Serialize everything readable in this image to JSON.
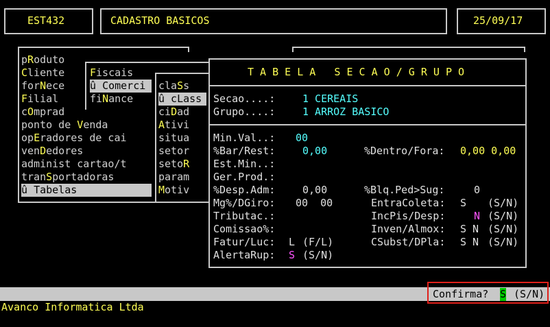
{
  "header": {
    "program": "EST432",
    "title": "CADASTRO BASICOS",
    "date": "25/09/17"
  },
  "menu1": {
    "items": [
      {
        "pre": "p",
        "key": "R",
        "post": "oduto"
      },
      {
        "pre": "",
        "key": "C",
        "post": "liente"
      },
      {
        "pre": "for",
        "key": "N",
        "post": "ece"
      },
      {
        "pre": "",
        "key": "F",
        "post": "ilial"
      },
      {
        "pre": "c",
        "key": "O",
        "post": "mprad"
      },
      {
        "pre": "ponto de ",
        "key": "V",
        "post": "enda"
      },
      {
        "pre": "op",
        "key": "E",
        "post": "radores de cai"
      },
      {
        "pre": "ven",
        "key": "D",
        "post": "edores"
      },
      {
        "pre": "administ cartao/t",
        "key": "",
        "post": ""
      },
      {
        "pre": "tran",
        "key": "S",
        "post": "portadoras"
      },
      {
        "pre": "û ",
        "key": "T",
        "post": "abelas"
      }
    ]
  },
  "menu2": {
    "items": [
      {
        "pre": "",
        "key": "F",
        "post": "iscais"
      },
      {
        "pre": "û ",
        "key": "C",
        "post": "omerci"
      },
      {
        "pre": "fi",
        "key": "N",
        "post": "ance"
      }
    ]
  },
  "menu3": {
    "items": [
      {
        "pre": "cla",
        "key": "S",
        "post": "s"
      },
      {
        "pre": "û c",
        "key": "L",
        "post": "ass"
      },
      {
        "pre": "ci",
        "key": "D",
        "post": "ad"
      },
      {
        "pre": "",
        "key": "A",
        "post": "tivi"
      },
      {
        "pre": "situa",
        "key": "",
        "post": ""
      },
      {
        "pre": "setor",
        "key": "",
        "post": ""
      },
      {
        "pre": "seto",
        "key": "R",
        "post": ""
      },
      {
        "pre": "param",
        "key": "",
        "post": ""
      },
      {
        "pre": "",
        "key": "M",
        "post": "otiv"
      }
    ]
  },
  "dialog": {
    "title": "T A B E L A   S E C A O / G R U P O",
    "secao_label": "Secao....:",
    "secao_value": "1 CEREAIS",
    "grupo_label": "Grupo....:",
    "grupo_value": "1 ARROZ BASICO",
    "minval_label": "Min.Val..:",
    "minval_value": "00",
    "barrest_label": "%Bar/Rest:",
    "barrest_value": "0,00",
    "dentro_label": "%Dentro/Fora:",
    "dentro_value": "0,00 0,00",
    "estmin_label": "Est.Min..:",
    "gerprod_label": "Ger.Prod.:",
    "despadm_label": "%Desp.Adm:",
    "despadm_value": "0,00",
    "blqped_label": "%Blq.Ped>Sug:",
    "blqped_value": "0",
    "mgdgiro_label": "Mg%/DGiro:",
    "mgdgiro_value": "00  00",
    "entracoleta_label": "EntraColeta:",
    "entracoleta_value": "S",
    "entracoleta_opt": "(S/N)",
    "tributac_label": "Tributac.:",
    "incpis_label": "IncPis/Desp:",
    "incpis_value": "N",
    "incpis_opt": "(S/N)",
    "comissao_label": "Comissao%:",
    "inven_label": "Inven/Almox:",
    "inven_value": "S N",
    "inven_opt": "(S/N)",
    "faturluc_label": "Fatur/Luc:",
    "faturluc_value": "L",
    "faturluc_opt": "(F/L)",
    "csubst_label": "CSubst/DPla:",
    "csubst_value": "S N",
    "csubst_opt": "(S/N)",
    "alerta_label": "AlertaRup:",
    "alerta_value": "S",
    "alerta_opt": "(S/N)"
  },
  "statusbar": {
    "prompt": "Confirma?",
    "answer": "S",
    "options": "(S/N)"
  },
  "footer": {
    "company": "Avanco Informatica Ltda"
  }
}
